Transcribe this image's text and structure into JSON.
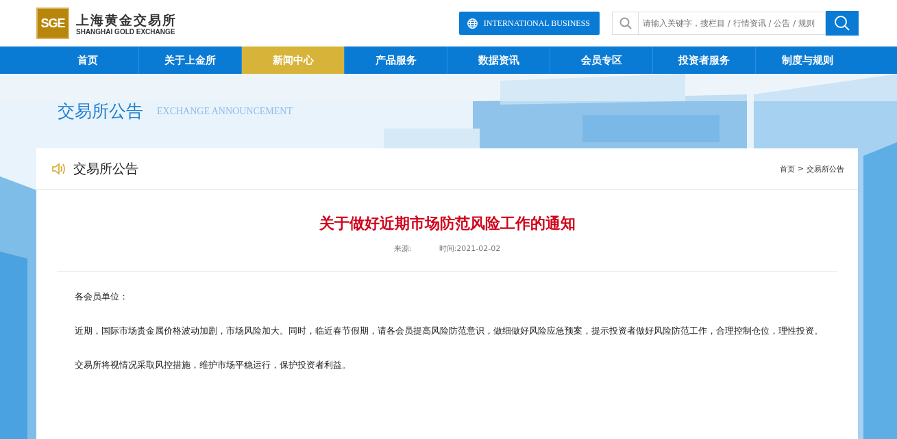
{
  "logo": {
    "mark": "SGE",
    "name_cn": "上海黄金交易所",
    "name_en": "SHANGHAI GOLD EXCHANGE"
  },
  "intl_button": "INTERNATIONAL BUSINESS",
  "search": {
    "placeholder": "请输入关键字，搜栏目 / 行情资讯 / 公告 / 规则"
  },
  "nav": [
    {
      "label": "首页",
      "selected": false
    },
    {
      "label": "关于上金所",
      "selected": false
    },
    {
      "label": "新闻中心",
      "selected": true
    },
    {
      "label": "产品服务",
      "selected": false
    },
    {
      "label": "数据资讯",
      "selected": false
    },
    {
      "label": "会员专区",
      "selected": false
    },
    {
      "label": "投资者服务",
      "selected": false
    },
    {
      "label": "制度与规则",
      "selected": false
    }
  ],
  "banner": {
    "title": "交易所公告",
    "subtitle": "EXCHANGE ANNOUNCEMENT"
  },
  "section": {
    "title": "交易所公告",
    "breadcrumb": [
      {
        "label": "首页"
      },
      {
        "label": "交易所公告"
      }
    ],
    "separator": ">"
  },
  "article": {
    "title": "关于做好近期市场防范风险工作的通知",
    "source": "来源:",
    "time": "时间:2021-02-02",
    "paragraphs": [
      "各会员单位：",
      "近期，国际市场贵金属价格波动加剧，市场风险加大。同时，临近春节假期，请各会员提高风险防范意识，做细做好风险应急预案，提示投资者做好风险防范工作，合理控制仓位，理性投资。",
      "交易所将视情况采取风控措施，维护市场平稳运行，保护投资者利益。"
    ]
  }
}
